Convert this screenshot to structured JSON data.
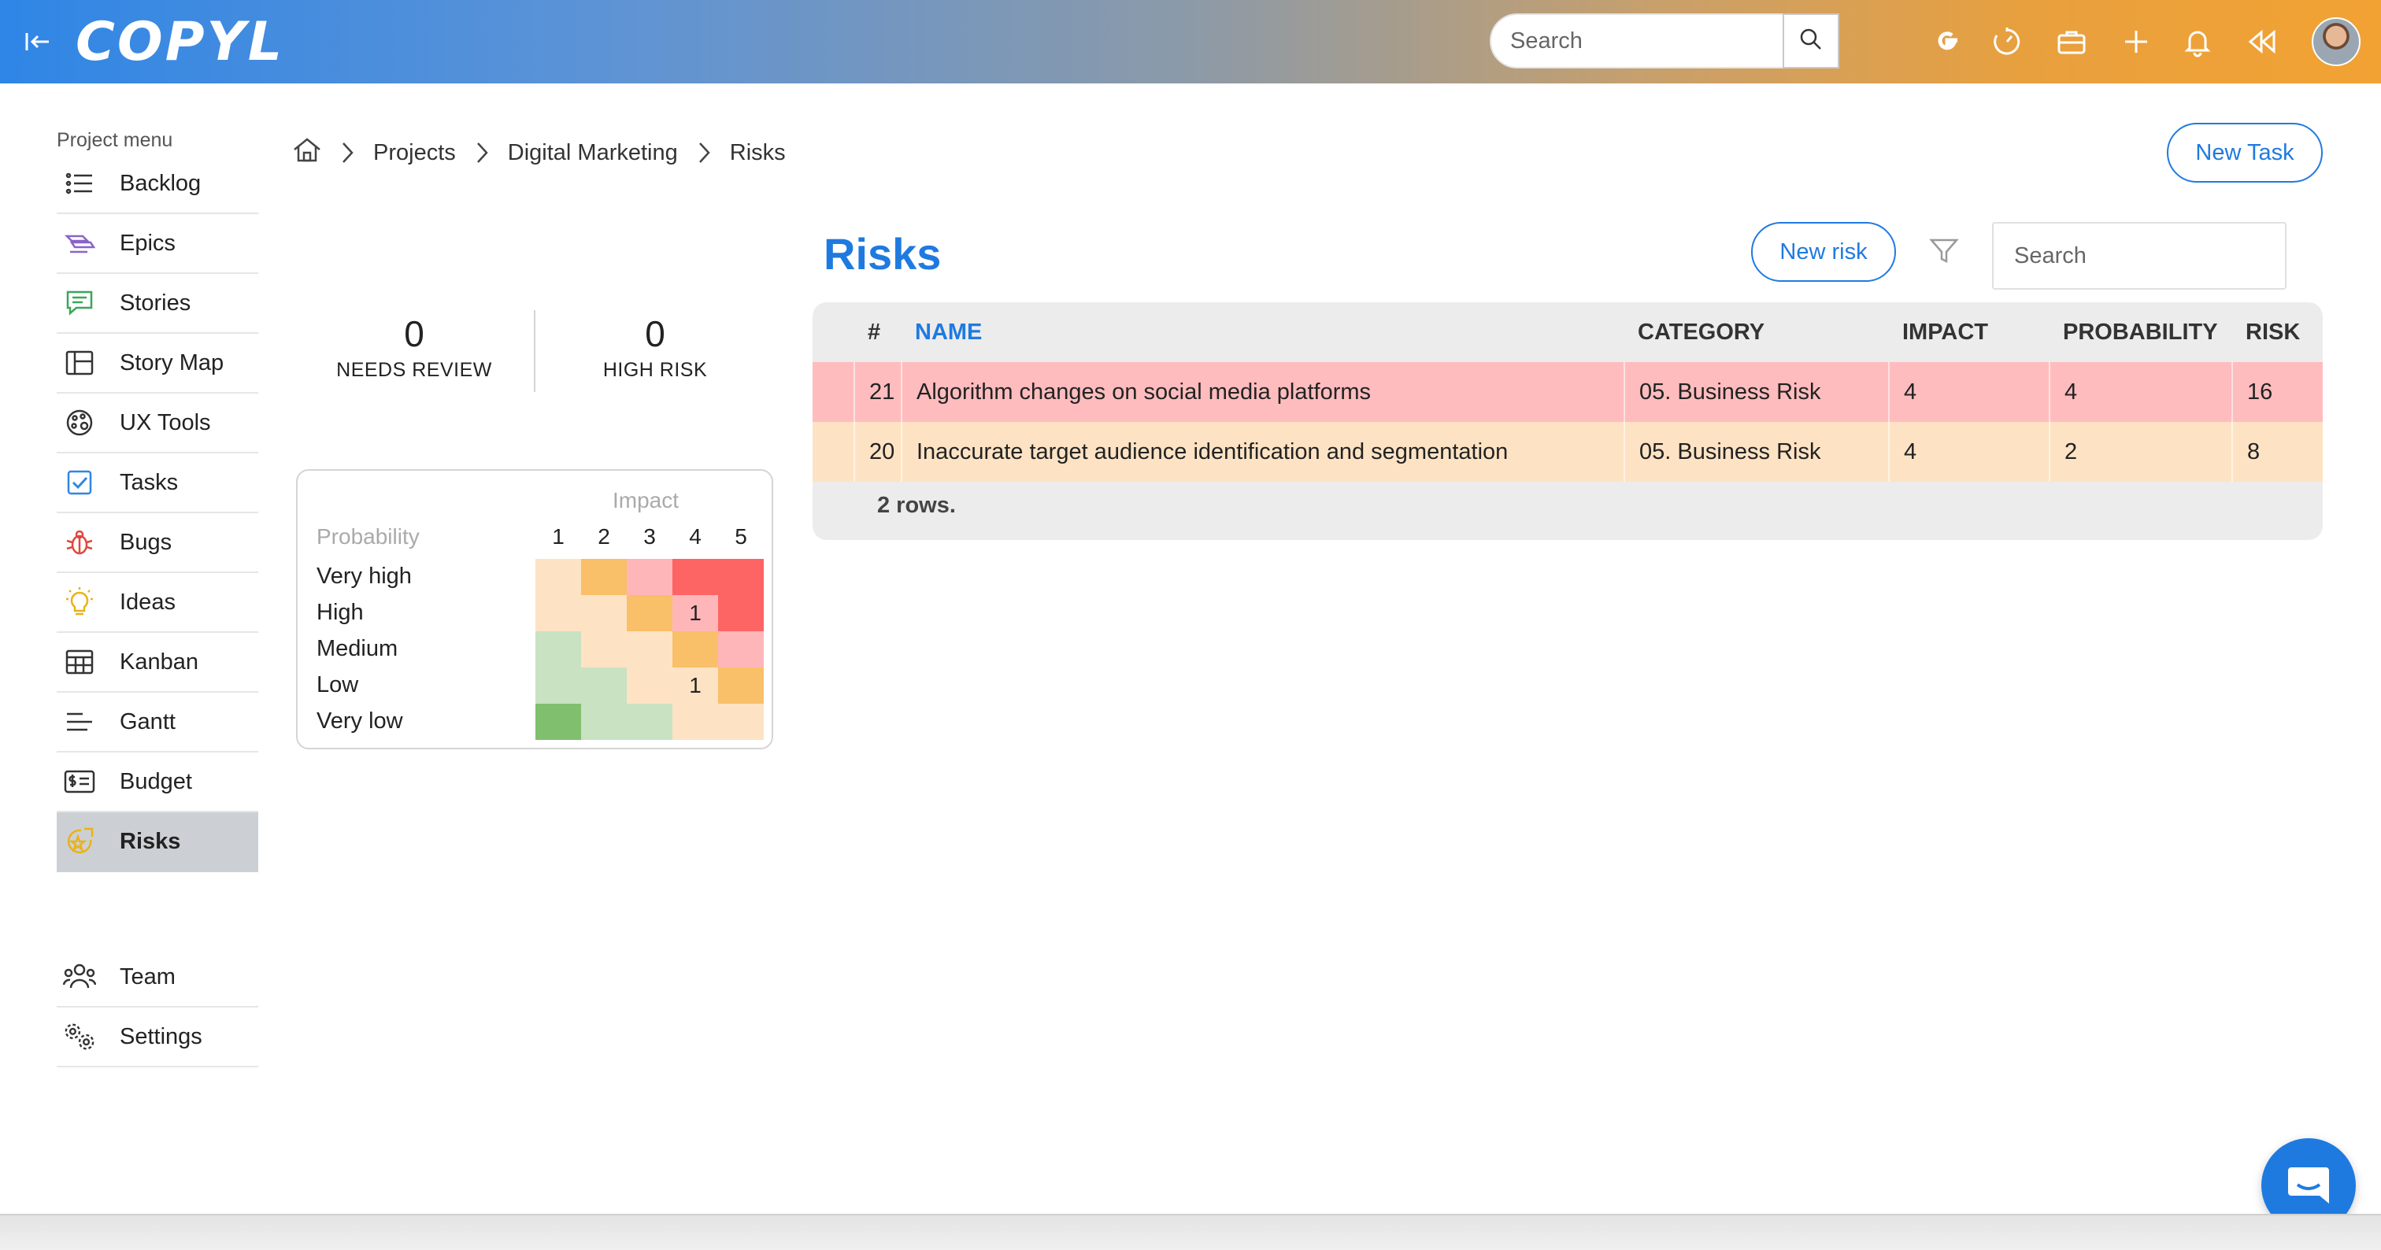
{
  "header": {
    "logo": "COPYL",
    "search_placeholder": "Search",
    "icons": [
      "collapse-sidebar-icon",
      "google-icon",
      "timer-icon",
      "toolbox-icon",
      "plus-icon",
      "bell-icon",
      "rewind-icon",
      "search-icon"
    ]
  },
  "sidebar": {
    "title": "Project menu",
    "items": [
      {
        "label": "Backlog",
        "icon": "list-icon"
      },
      {
        "label": "Epics",
        "icon": "epics-icon"
      },
      {
        "label": "Stories",
        "icon": "chat-bubble-icon"
      },
      {
        "label": "Story Map",
        "icon": "story-map-icon"
      },
      {
        "label": "UX Tools",
        "icon": "palette-icon"
      },
      {
        "label": "Tasks",
        "icon": "checkbox-icon"
      },
      {
        "label": "Bugs",
        "icon": "bug-icon"
      },
      {
        "label": "Ideas",
        "icon": "lightbulb-icon"
      },
      {
        "label": "Kanban",
        "icon": "kanban-icon"
      },
      {
        "label": "Gantt",
        "icon": "gantt-icon"
      },
      {
        "label": "Budget",
        "icon": "budget-icon"
      },
      {
        "label": "Risks",
        "icon": "risks-icon",
        "active": true
      }
    ],
    "bottom_items": [
      {
        "label": "Team",
        "icon": "team-icon"
      },
      {
        "label": "Settings",
        "icon": "settings-icon"
      }
    ]
  },
  "breadcrumb": {
    "items": [
      "Projects",
      "Digital Marketing",
      "Risks"
    ],
    "home_icon": "home-icon",
    "separator_icon": "chevron-right-icon"
  },
  "actions": {
    "new_task": "New Task",
    "new_risk": "New risk",
    "table_search_placeholder": "Search"
  },
  "stats": {
    "needs_review": {
      "value": "0",
      "label": "NEEDS REVIEW"
    },
    "high_risk": {
      "value": "0",
      "label": "HIGH RISK"
    }
  },
  "matrix": {
    "impact_label": "Impact",
    "probability_label": "Probability",
    "impact_levels": [
      "1",
      "2",
      "3",
      "4",
      "5"
    ],
    "probability_levels": [
      "Very high",
      "High",
      "Medium",
      "Low",
      "Very low"
    ],
    "cell_colors": [
      [
        "#fde3c4",
        "#f9bf69",
        "#ffb6b9",
        "#fd6464",
        "#fd6464"
      ],
      [
        "#fde3c4",
        "#fde3c4",
        "#f9bf69",
        "#ffb6b9",
        "#fd6464"
      ],
      [
        "#c8e2c2",
        "#fde3c4",
        "#fde3c4",
        "#f9bf69",
        "#ffb6b9"
      ],
      [
        "#c8e2c2",
        "#c8e2c2",
        "#fde3c4",
        "#fde3c4",
        "#f9bf69"
      ],
      [
        "#7fbf6e",
        "#c8e2c2",
        "#c8e2c2",
        "#fde3c4",
        "#fde3c4"
      ]
    ],
    "cell_counts": [
      [
        "",
        "",
        "",
        "",
        ""
      ],
      [
        "",
        "",
        "",
        "1",
        ""
      ],
      [
        "",
        "",
        "",
        "",
        ""
      ],
      [
        "",
        "",
        "",
        "1",
        ""
      ],
      [
        "",
        "",
        "",
        "",
        ""
      ]
    ]
  },
  "page": {
    "title": "Risks"
  },
  "table": {
    "columns": [
      "#",
      "NAME",
      "CATEGORY",
      "IMPACT",
      "PROBABILITY",
      "RISK"
    ],
    "sorted_column": "NAME",
    "rows": [
      {
        "id": "21",
        "name": "Algorithm changes on social media platforms",
        "category": "05. Business Risk",
        "impact": "4",
        "probability": "4",
        "risk": "16",
        "color": "#ffbcbe"
      },
      {
        "id": "20",
        "name": "Inaccurate target audience identification and segmentation",
        "category": "05. Business Risk",
        "impact": "4",
        "probability": "2",
        "risk": "8",
        "color": "#fde3c4"
      }
    ],
    "footer": "2 rows."
  },
  "colors": {
    "accent": "#1f7ae0",
    "active_sidebar": "#ccd0d4",
    "table_bg": "#ececec"
  }
}
